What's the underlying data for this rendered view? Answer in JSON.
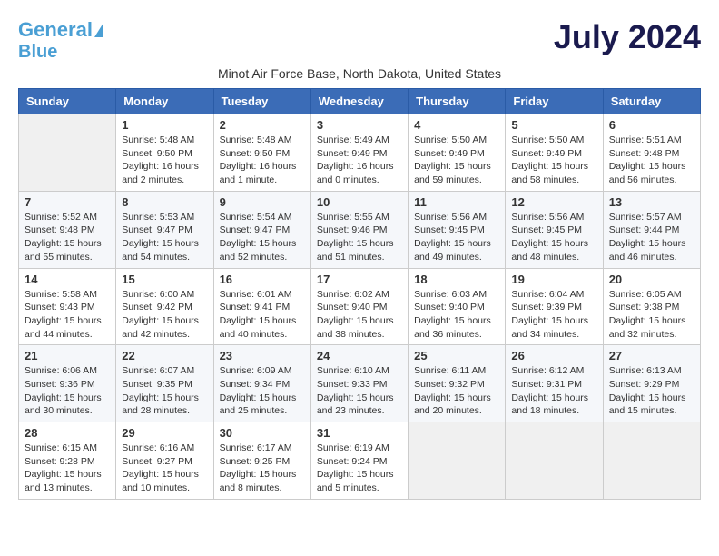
{
  "header": {
    "logo_line1": "General",
    "logo_line2": "Blue",
    "month_title": "July 2024",
    "subtitle": "Minot Air Force Base, North Dakota, United States"
  },
  "columns": [
    "Sunday",
    "Monday",
    "Tuesday",
    "Wednesday",
    "Thursday",
    "Friday",
    "Saturday"
  ],
  "weeks": [
    [
      {
        "day": "",
        "info": ""
      },
      {
        "day": "1",
        "info": "Sunrise: 5:48 AM\nSunset: 9:50 PM\nDaylight: 16 hours\nand 2 minutes."
      },
      {
        "day": "2",
        "info": "Sunrise: 5:48 AM\nSunset: 9:50 PM\nDaylight: 16 hours\nand 1 minute."
      },
      {
        "day": "3",
        "info": "Sunrise: 5:49 AM\nSunset: 9:49 PM\nDaylight: 16 hours\nand 0 minutes."
      },
      {
        "day": "4",
        "info": "Sunrise: 5:50 AM\nSunset: 9:49 PM\nDaylight: 15 hours\nand 59 minutes."
      },
      {
        "day": "5",
        "info": "Sunrise: 5:50 AM\nSunset: 9:49 PM\nDaylight: 15 hours\nand 58 minutes."
      },
      {
        "day": "6",
        "info": "Sunrise: 5:51 AM\nSunset: 9:48 PM\nDaylight: 15 hours\nand 56 minutes."
      }
    ],
    [
      {
        "day": "7",
        "info": "Sunrise: 5:52 AM\nSunset: 9:48 PM\nDaylight: 15 hours\nand 55 minutes."
      },
      {
        "day": "8",
        "info": "Sunrise: 5:53 AM\nSunset: 9:47 PM\nDaylight: 15 hours\nand 54 minutes."
      },
      {
        "day": "9",
        "info": "Sunrise: 5:54 AM\nSunset: 9:47 PM\nDaylight: 15 hours\nand 52 minutes."
      },
      {
        "day": "10",
        "info": "Sunrise: 5:55 AM\nSunset: 9:46 PM\nDaylight: 15 hours\nand 51 minutes."
      },
      {
        "day": "11",
        "info": "Sunrise: 5:56 AM\nSunset: 9:45 PM\nDaylight: 15 hours\nand 49 minutes."
      },
      {
        "day": "12",
        "info": "Sunrise: 5:56 AM\nSunset: 9:45 PM\nDaylight: 15 hours\nand 48 minutes."
      },
      {
        "day": "13",
        "info": "Sunrise: 5:57 AM\nSunset: 9:44 PM\nDaylight: 15 hours\nand 46 minutes."
      }
    ],
    [
      {
        "day": "14",
        "info": "Sunrise: 5:58 AM\nSunset: 9:43 PM\nDaylight: 15 hours\nand 44 minutes."
      },
      {
        "day": "15",
        "info": "Sunrise: 6:00 AM\nSunset: 9:42 PM\nDaylight: 15 hours\nand 42 minutes."
      },
      {
        "day": "16",
        "info": "Sunrise: 6:01 AM\nSunset: 9:41 PM\nDaylight: 15 hours\nand 40 minutes."
      },
      {
        "day": "17",
        "info": "Sunrise: 6:02 AM\nSunset: 9:40 PM\nDaylight: 15 hours\nand 38 minutes."
      },
      {
        "day": "18",
        "info": "Sunrise: 6:03 AM\nSunset: 9:40 PM\nDaylight: 15 hours\nand 36 minutes."
      },
      {
        "day": "19",
        "info": "Sunrise: 6:04 AM\nSunset: 9:39 PM\nDaylight: 15 hours\nand 34 minutes."
      },
      {
        "day": "20",
        "info": "Sunrise: 6:05 AM\nSunset: 9:38 PM\nDaylight: 15 hours\nand 32 minutes."
      }
    ],
    [
      {
        "day": "21",
        "info": "Sunrise: 6:06 AM\nSunset: 9:36 PM\nDaylight: 15 hours\nand 30 minutes."
      },
      {
        "day": "22",
        "info": "Sunrise: 6:07 AM\nSunset: 9:35 PM\nDaylight: 15 hours\nand 28 minutes."
      },
      {
        "day": "23",
        "info": "Sunrise: 6:09 AM\nSunset: 9:34 PM\nDaylight: 15 hours\nand 25 minutes."
      },
      {
        "day": "24",
        "info": "Sunrise: 6:10 AM\nSunset: 9:33 PM\nDaylight: 15 hours\nand 23 minutes."
      },
      {
        "day": "25",
        "info": "Sunrise: 6:11 AM\nSunset: 9:32 PM\nDaylight: 15 hours\nand 20 minutes."
      },
      {
        "day": "26",
        "info": "Sunrise: 6:12 AM\nSunset: 9:31 PM\nDaylight: 15 hours\nand 18 minutes."
      },
      {
        "day": "27",
        "info": "Sunrise: 6:13 AM\nSunset: 9:29 PM\nDaylight: 15 hours\nand 15 minutes."
      }
    ],
    [
      {
        "day": "28",
        "info": "Sunrise: 6:15 AM\nSunset: 9:28 PM\nDaylight: 15 hours\nand 13 minutes."
      },
      {
        "day": "29",
        "info": "Sunrise: 6:16 AM\nSunset: 9:27 PM\nDaylight: 15 hours\nand 10 minutes."
      },
      {
        "day": "30",
        "info": "Sunrise: 6:17 AM\nSunset: 9:25 PM\nDaylight: 15 hours\nand 8 minutes."
      },
      {
        "day": "31",
        "info": "Sunrise: 6:19 AM\nSunset: 9:24 PM\nDaylight: 15 hours\nand 5 minutes."
      },
      {
        "day": "",
        "info": ""
      },
      {
        "day": "",
        "info": ""
      },
      {
        "day": "",
        "info": ""
      }
    ]
  ]
}
